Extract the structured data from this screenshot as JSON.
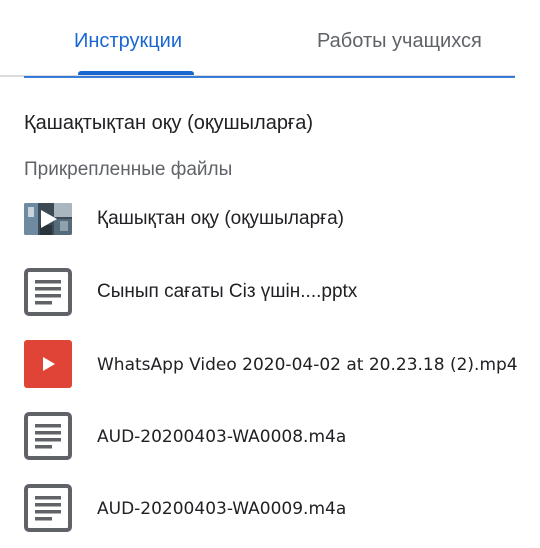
{
  "tabs": {
    "instructions": "Инструкции",
    "student_work": "Работы учащихся"
  },
  "assignment": {
    "title": "Қашақтықтан оқу (оқушыларға)"
  },
  "attachments_section": {
    "title": "Прикрепленные файлы",
    "items": [
      {
        "name": "Қашықтан оқу (оқушыларға)",
        "icon": "video-thumbnail-icon"
      },
      {
        "name": "Сынып сағаты  Сіз үшін....pptx",
        "icon": "document-icon"
      },
      {
        "name": "WhatsApp Video 2020-04-02 at 20.23.18 (2).mp4",
        "icon": "video-play-icon"
      },
      {
        "name": "AUD-20200403-WA0008.m4a",
        "icon": "document-icon"
      },
      {
        "name": "AUD-20200403-WA0009.m4a",
        "icon": "document-icon"
      }
    ]
  },
  "colors": {
    "accent": "#1967d2",
    "video_red": "#e04437",
    "doc_gray": "#5f6368"
  }
}
